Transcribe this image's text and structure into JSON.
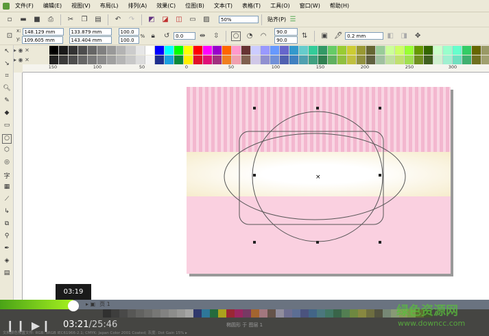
{
  "menu": [
    "文件(F)",
    "编辑(E)",
    "视图(V)",
    "布局(L)",
    "排列(A)",
    "效果(C)",
    "位图(B)",
    "文本(T)",
    "表格(T)",
    "工具(O)",
    "窗口(W)",
    "帮助(H)"
  ],
  "toolbar": {
    "zoom": "50%",
    "snap": "贴齐(P)"
  },
  "property_bar": {
    "x": "148.129 mm",
    "y": "109.605 mm",
    "width": "133.879 mm",
    "height": "143.404 mm",
    "scale_x": "100.0",
    "scale_y": "100.0",
    "percent": "%",
    "rotation": "0.0",
    "start_angle": "90.0",
    "end_angle": "90.0",
    "outline": "0.2 mm",
    "x_label": "x:",
    "y_label": "y:"
  },
  "palette_row1": [
    "#000000",
    "#1a1a1a",
    "#333333",
    "#4d4d4d",
    "#666666",
    "#808080",
    "#999999",
    "#b3b3b3",
    "#cccccc",
    "#e6e6e6",
    "#ffffff",
    "#0000ff",
    "#00ffff",
    "#00ff00",
    "#ffff00",
    "#ff0000",
    "#ff00ff",
    "#9900cc",
    "#ff6600",
    "#ff99cc",
    "#663333",
    "#ccccff",
    "#9999ff",
    "#6699ff",
    "#6666cc",
    "#3399cc",
    "#66cccc",
    "#33cc99",
    "#339966",
    "#66cc66",
    "#99cc33",
    "#cccc33",
    "#999933",
    "#666633",
    "#99cc99",
    "#ccff99",
    "#ccff66",
    "#99ff33",
    "#669900",
    "#336600",
    "#ccffcc",
    "#99ffcc",
    "#66ffcc",
    "#33cc66",
    "#666600",
    "#999966",
    "#cccc99",
    "#333300"
  ],
  "palette_row2": [
    "#222222",
    "#3a3a3a",
    "#4d4d4d",
    "#666666",
    "#7a7a7a",
    "#8c8c8c",
    "#a0a0a0",
    "#b5b5b5",
    "#c8c8c8",
    "#dcdcdc",
    "#f5f5f5",
    "#1f2f8f",
    "#1ca0e0",
    "#0a8a3a",
    "#ffee00",
    "#e0102a",
    "#e0107a",
    "#a03080",
    "#f08020",
    "#f0a0b0",
    "#806050",
    "#d0c8e8",
    "#9090d0",
    "#7090d8",
    "#5060b0",
    "#4080c0",
    "#50a0b0",
    "#40a080",
    "#308050",
    "#60b060",
    "#90c040",
    "#c0c040",
    "#909040",
    "#606040",
    "#a0c0a0",
    "#c0e0a0",
    "#c0e070",
    "#a0e050",
    "#709020",
    "#406020",
    "#d0f0d0",
    "#a0f0d0",
    "#70e0c0",
    "#40b070",
    "#707020",
    "#a0a070",
    "#d0d0a0",
    "#404020"
  ],
  "ruler_labels": [
    "150",
    "100",
    "50",
    "0",
    "50",
    "100",
    "150",
    "200",
    "250",
    "300"
  ],
  "page_tab": "页 1",
  "video": {
    "hover_time": "03:19",
    "current": "03:21",
    "total": "/25:46",
    "progress": 0.15
  },
  "status": "文档颜色预置文件: RGB: sRGB IEC61966-2.1; CMYK: Japan Color 2001 Coated; 灰度: Dot Gain 15% ▸",
  "layer_text": "椭圆形 于 图层 1",
  "watermark": {
    "title": "绿色资源网",
    "url": "www.downcc.com"
  },
  "colors": {
    "accent": "#8fe01a",
    "stripe": "#f3b7cf",
    "pink": "#fad0e0",
    "cream": "#f6eccc"
  }
}
